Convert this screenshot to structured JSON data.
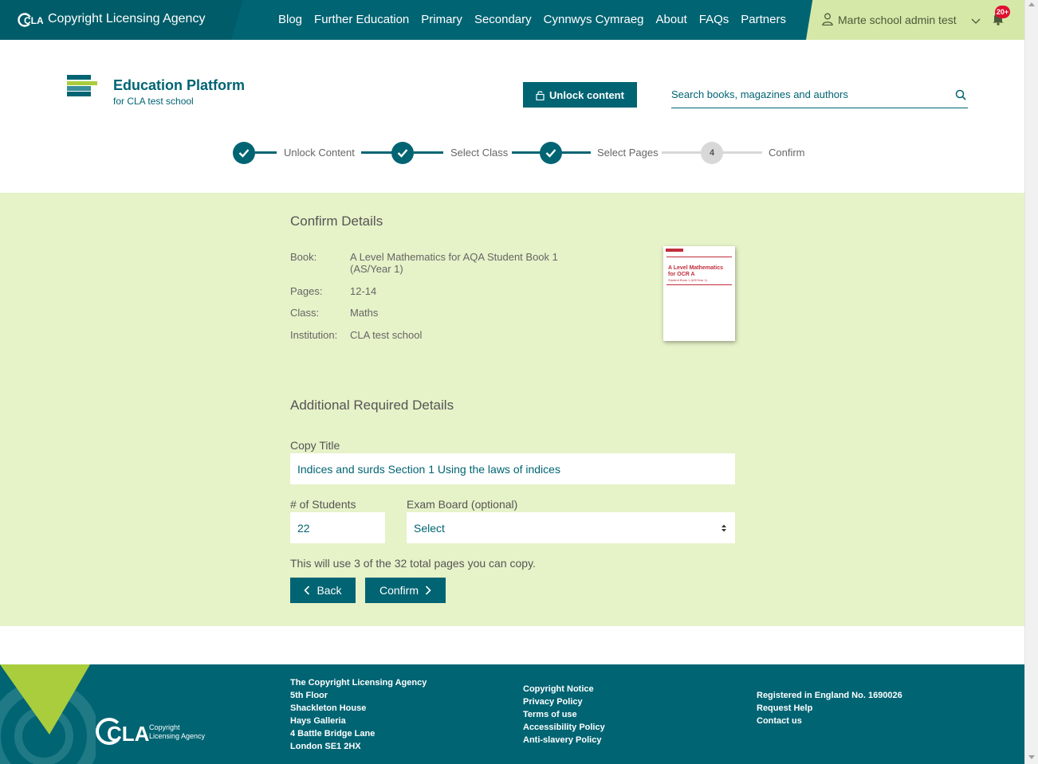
{
  "topbar": {
    "brand": "Copyright Licensing Agency",
    "brand_mark": "CLA",
    "nav": [
      "Blog",
      "Further Education",
      "Primary",
      "Secondary",
      "Cynnwys Cymraeg",
      "About",
      "FAQs",
      "Partners"
    ],
    "user_name": "Marte school admin test",
    "notifications_badge": "20+",
    "icons": [
      "user-icon",
      "chevron-down-icon",
      "bell-icon"
    ]
  },
  "header": {
    "title": "Education Platform",
    "subtitle": "for CLA test school",
    "unlock_label": "Unlock content",
    "search_placeholder": "Search books, magazines and authors"
  },
  "stepper": {
    "steps": [
      {
        "label": "Unlock Content",
        "status": "complete"
      },
      {
        "label": "Select Class",
        "status": "complete"
      },
      {
        "label": "Select Pages",
        "status": "complete"
      },
      {
        "label": "Confirm",
        "status": "current",
        "number": "4"
      }
    ]
  },
  "confirm": {
    "title": "Confirm Details",
    "book_label": "Book:",
    "book_value": "A Level Mathematics for AQA Student Book 1 (AS/Year 1)",
    "pages_label": "Pages:",
    "pages_value": "12-14",
    "class_label": "Class:",
    "class_value": "Maths",
    "institution_label": "Institution:",
    "institution_value": "CLA test school",
    "cover": {
      "title": "A Level Mathematics for OCR A",
      "subtitle": "Student Book 1 (AS/Year 1)"
    }
  },
  "additional": {
    "title": "Additional Required Details",
    "copy_title_label": "Copy Title",
    "copy_title_value": "Indices and surds Section 1 Using the laws of indices",
    "students_label": "# of Students",
    "students_value": "22",
    "exam_board_label": "Exam Board (optional)",
    "exam_board_value": "Select",
    "usage_note": "This will use 3 of the 32 total pages you can copy.",
    "back_label": "Back",
    "confirm_label": "Confirm"
  },
  "footer": {
    "address": [
      "The Copyright Licensing Agency",
      "5th Floor",
      "Shackleton House",
      "Hays Galleria",
      "4 Battle Bridge Lane",
      "London SE1 2HX"
    ],
    "links": [
      "Copyright Notice",
      "Privacy Policy",
      "Terms of use",
      "Accessibility Policy",
      "Anti-slavery Policy"
    ],
    "registration": "Registered in England No. 1690026",
    "help_links": [
      "Request Help",
      "Contact us"
    ],
    "logo_mark": "CLA",
    "logo_text_1": "Copyright",
    "logo_text_2": "Licensing Agency"
  },
  "colors": {
    "primary": "#006473",
    "lime": "#d6e8a8",
    "band": "#e6f2c8",
    "badge": "#e01030"
  }
}
